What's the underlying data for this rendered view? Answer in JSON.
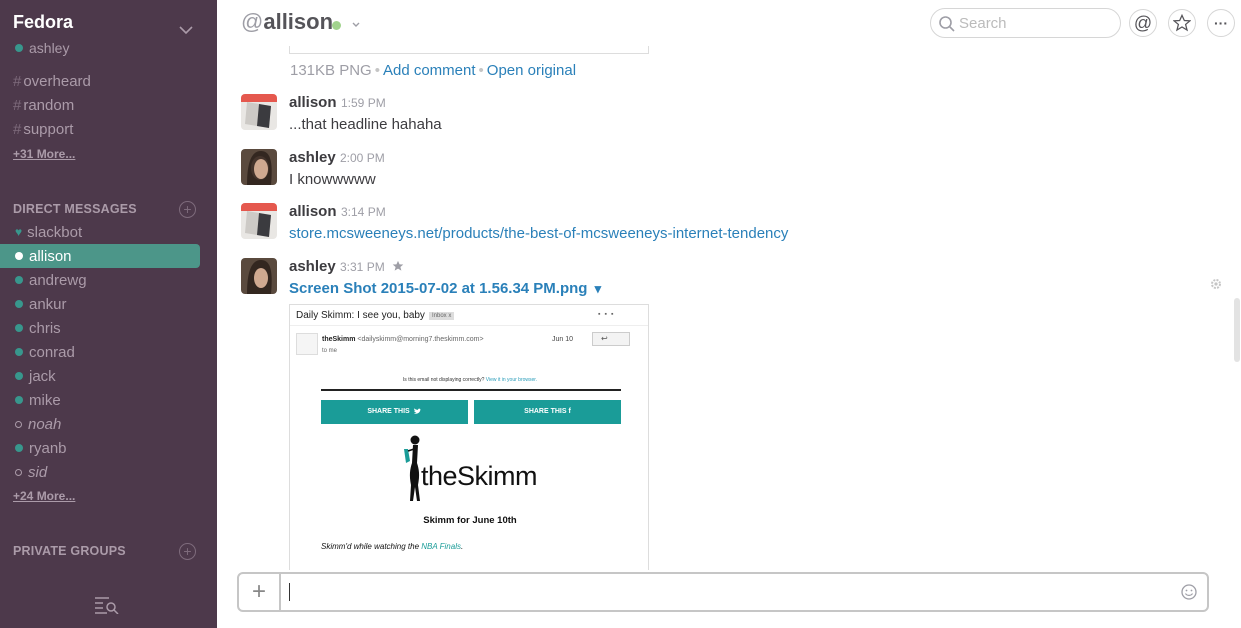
{
  "sidebar": {
    "team_name": "Fedora",
    "current_user": "ashley",
    "channels": [
      {
        "hash": "#",
        "name": "overheard"
      },
      {
        "hash": "#",
        "name": "random"
      },
      {
        "hash": "#",
        "name": "support"
      }
    ],
    "channels_more": "+31 More...",
    "dm_header": "DIRECT MESSAGES",
    "dms": [
      {
        "name": "slackbot",
        "status": "bot"
      },
      {
        "name": "allison",
        "status": "active-selected"
      },
      {
        "name": "andrewg",
        "status": "online"
      },
      {
        "name": "ankur",
        "status": "online"
      },
      {
        "name": "chris",
        "status": "online"
      },
      {
        "name": "conrad",
        "status": "online"
      },
      {
        "name": "jack",
        "status": "online"
      },
      {
        "name": "mike",
        "status": "online"
      },
      {
        "name": "noah",
        "status": "away"
      },
      {
        "name": "ryanb",
        "status": "online"
      },
      {
        "name": "sid",
        "status": "away"
      }
    ],
    "dms_more": "+24 More...",
    "groups_header": "PRIVATE GROUPS",
    "plus_glyph": "+"
  },
  "header": {
    "at": "@",
    "channel_name": "allison",
    "search_placeholder": "Search",
    "mention_glyph": "@",
    "more_glyph": "···"
  },
  "messages": {
    "file_meta": {
      "size": "131KB PNG",
      "sep": "•",
      "add_comment": "Add comment",
      "open_original": "Open original"
    },
    "items": [
      {
        "user": "allison",
        "time": "1:59 PM",
        "text": "...that headline hahaha"
      },
      {
        "user": "ashley",
        "time": "2:00 PM",
        "text": "I knowwwww"
      },
      {
        "user": "allison",
        "time": "3:14 PM",
        "text": "store.mcsweeneys.net/products/the-best-of-mcsweeneys-internet-tendency"
      },
      {
        "user": "ashley",
        "time": "3:31 PM",
        "file_title": "Screen Shot 2015-07-02 at 1.56.34 PM.png",
        "caret": "▾"
      }
    ]
  },
  "preview": {
    "subject": "Daily Skimm: I see you, baby",
    "inbox_tag": "Inbox  x",
    "icons": "▪▪▪",
    "from_name": "theSkimm",
    "from_email": "<dailyskimm@morning7.theskimm.com>",
    "to_me": "to me",
    "date": "Jun 10",
    "reply": "↩",
    "notice": "Is this email not displaying correctly?",
    "notice_link": "View it in your browser.",
    "share_twitter": "SHARE THIS",
    "share_facebook": "SHARE THIS  f",
    "logo": "theSkimm",
    "headline_date": "Skimm for June 10th",
    "watching": "Skimm'd while watching the",
    "watching_link": "NBA Finals",
    "watching_end": "."
  },
  "composer": {
    "plus": "+",
    "value": ""
  },
  "colors": {
    "sidebar_bg": "#4d394b",
    "sidebar_active": "#4c9689",
    "presence_online": "#38978d",
    "link": "#2a80b9",
    "skimm_teal": "#1a9c98"
  }
}
